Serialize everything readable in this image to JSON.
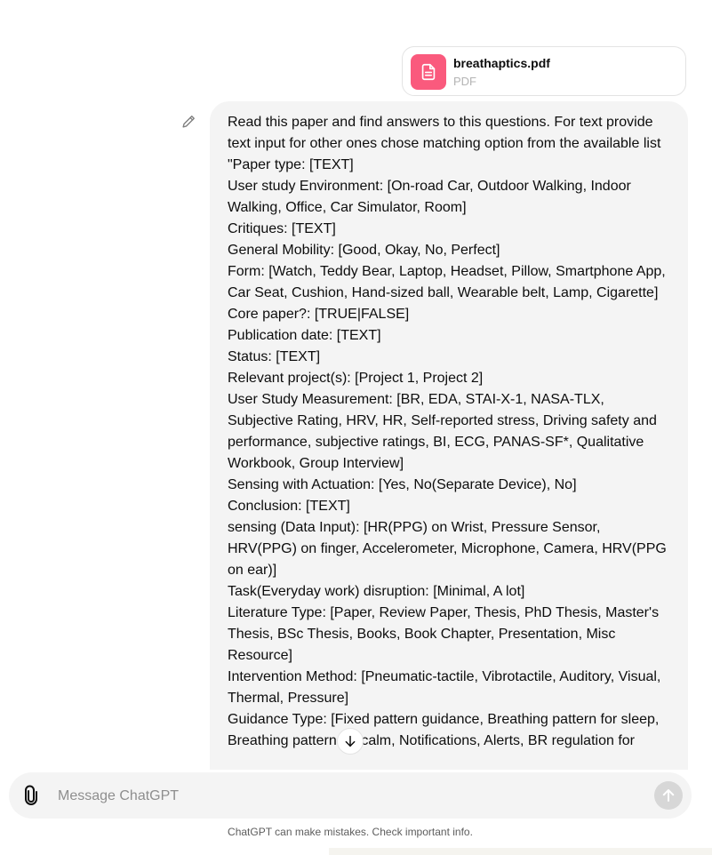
{
  "attachment": {
    "file_name": "breathaptics.pdf",
    "file_type": "PDF",
    "icon": "document-icon",
    "icon_color": "#fa5a7d"
  },
  "message": {
    "edit_icon": "pencil-icon",
    "text": "Read this paper and find answers to this questions. For text provide text input for other ones chose matching option from the available list \"Paper type: [TEXT]\nUser study Environment: [On-road Car, Outdoor Walking, Indoor Walking, Office, Car Simulator, Room]\nCritiques: [TEXT]\nGeneral Mobility: [Good, Okay, No, Perfect]\nForm: [Watch, Teddy Bear, Laptop, Headset, Pillow, Smartphone App, Car Seat, Cushion, Hand-sized ball, Wearable belt, Lamp, Cigarette]\nCore paper?: [TRUE|FALSE]\nPublication date: [TEXT]\nStatus: [TEXT]\nRelevant project(s): [Project 1, Project 2]\nUser Study Measurement: [BR, EDA, STAI-X-1, NASA-TLX, Subjective Rating, HRV, HR, Self-reported stress, Driving safety and performance, subjective ratings, BI, ECG, PANAS-SF*, Qualitative Workbook, Group Interview]\nSensing with Actuation: [Yes, No(Separate Device), No]\nConclusion: [TEXT]\nsensing (Data Input): [HR(PPG) on Wrist, Pressure Sensor, HRV(PPG) on finger, Accelerometer, Microphone, Camera, HRV(PPG on ear)]\nTask(Everyday work) disruption: [Minimal, A lot]\nLiterature Type: [Paper, Review Paper, Thesis, PhD Thesis, Master's Thesis, BSc Thesis, Books, Book Chapter, Presentation, Misc Resource]\nIntervention Method: [Pneumatic-tactile, Vibrotactile, Auditory, Visual, Thermal, Pressure]\nGuidance Type: [Fixed pattern guidance, Breathing pattern for sleep, Breathing pattern for calm, Notifications, Alerts, BR regulation for"
  },
  "scroll_button_icon": "arrow-down-icon",
  "composer": {
    "placeholder": "Message ChatGPT",
    "attach_icon": "paperclip-icon",
    "send_icon": "arrow-up-icon"
  },
  "footer_note": "ChatGPT can make mistakes. Check important info."
}
